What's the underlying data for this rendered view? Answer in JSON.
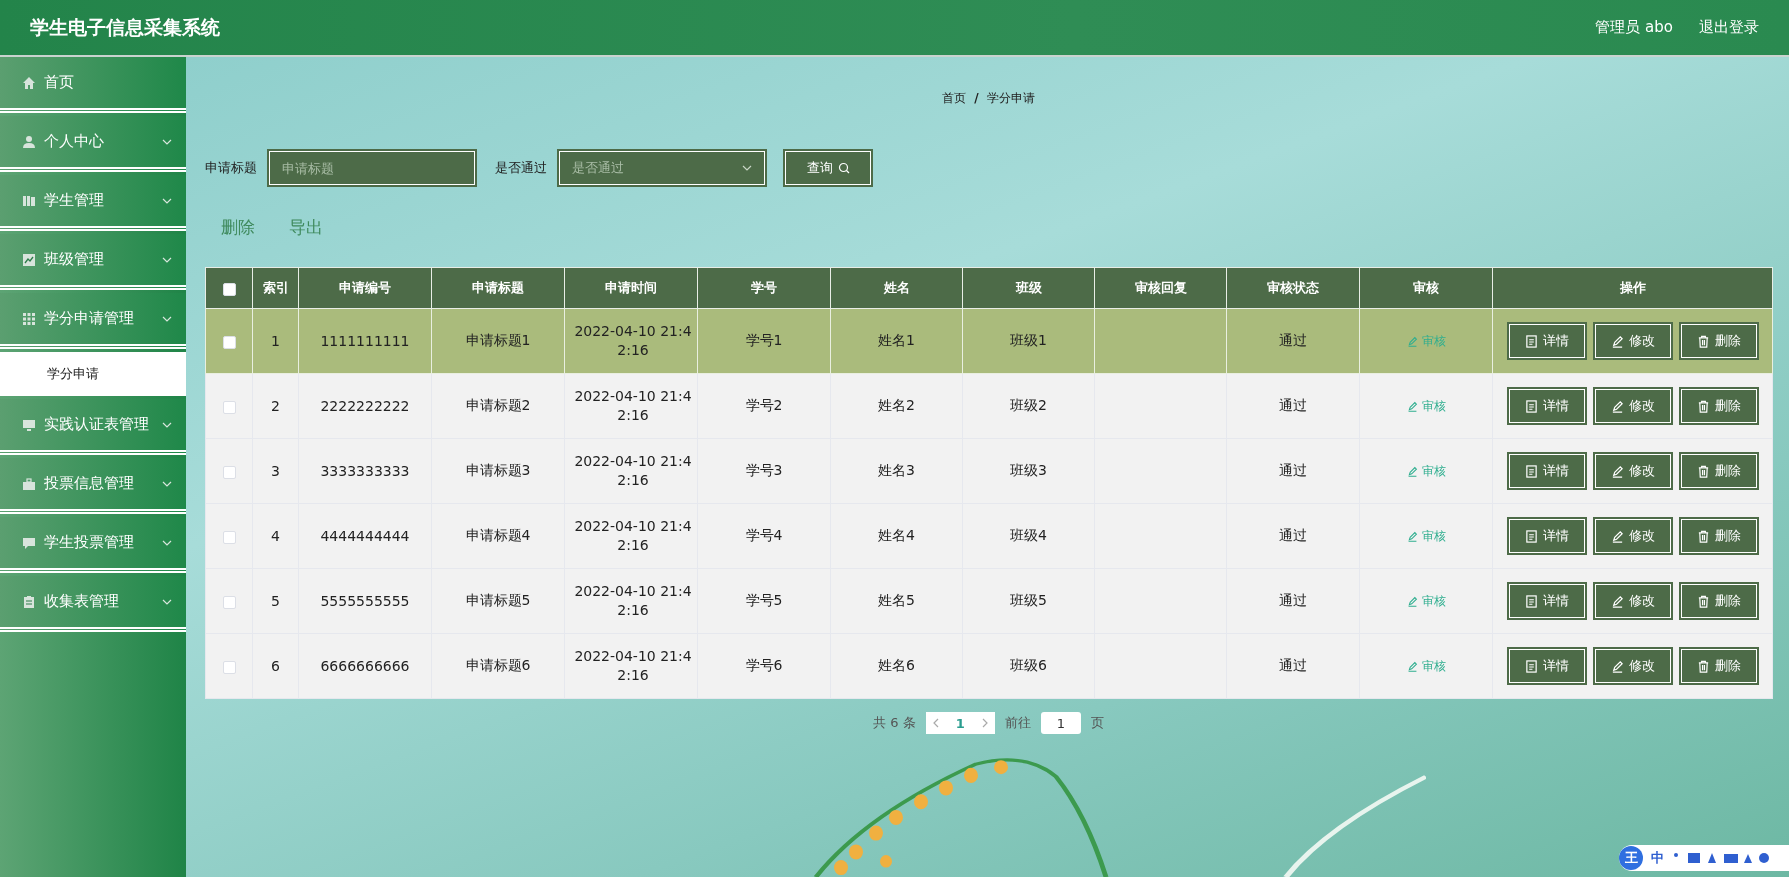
{
  "header": {
    "title": "学生电子信息采集系统",
    "user": "管理员 abo",
    "logout": "退出登录"
  },
  "sidebar": {
    "items": [
      {
        "label": "首页",
        "kind": "item"
      },
      {
        "label": "个人中心",
        "kind": "submenu"
      },
      {
        "label": "学生管理",
        "kind": "submenu"
      },
      {
        "label": "班级管理",
        "kind": "submenu"
      },
      {
        "label": "学分申请管理",
        "kind": "submenu",
        "children": [
          {
            "label": "学分申请",
            "selected": true
          }
        ]
      },
      {
        "label": "实践认证表管理",
        "kind": "submenu"
      },
      {
        "label": "投票信息管理",
        "kind": "submenu"
      },
      {
        "label": "学生投票管理",
        "kind": "submenu"
      },
      {
        "label": "收集表管理",
        "kind": "submenu"
      }
    ]
  },
  "breadcrumb": {
    "items": [
      "首页",
      "学分申请"
    ],
    "separator": "/"
  },
  "search": {
    "fields": [
      {
        "label": "申请标题",
        "placeholder": "申请标题",
        "kind": "input"
      },
      {
        "label": "是否通过",
        "placeholder": "是否通过",
        "kind": "select"
      }
    ],
    "button": "查询"
  },
  "actions": [
    "删除",
    "导出"
  ],
  "table": {
    "header_checked": false,
    "columns": [
      "索引",
      "申请编号",
      "申请标题",
      "申请时间",
      "学号",
      "姓名",
      "班级",
      "审核回复",
      "审核状态",
      "审核",
      "操作"
    ],
    "rows": [
      {
        "selected": true,
        "checked": false,
        "index": "1",
        "number": "1111111111",
        "title": "申请标题1",
        "time": "2022-04-10 21:42:16",
        "student_id": "学号1",
        "name": "姓名1",
        "class": "班级1",
        "status": "通过",
        "review": "审核",
        "actions": [
          "详情",
          "修改",
          "删除"
        ]
      },
      {
        "selected": false,
        "checked": false,
        "index": "2",
        "number": "2222222222",
        "title": "申请标题2",
        "time": "2022-04-10 21:42:16",
        "student_id": "学号2",
        "name": "姓名2",
        "class": "班级2",
        "status": "通过",
        "review": "审核",
        "actions": [
          "详情",
          "修改",
          "删除"
        ]
      },
      {
        "selected": false,
        "checked": false,
        "index": "3",
        "number": "3333333333",
        "title": "申请标题3",
        "time": "2022-04-10 21:42:16",
        "student_id": "学号3",
        "name": "姓名3",
        "class": "班级3",
        "status": "通过",
        "review": "审核",
        "actions": [
          "详情",
          "修改",
          "删除"
        ]
      },
      {
        "selected": false,
        "checked": false,
        "index": "4",
        "number": "4444444444",
        "title": "申请标题4",
        "time": "2022-04-10 21:42:16",
        "student_id": "学号4",
        "name": "姓名4",
        "class": "班级4",
        "status": "通过",
        "review": "审核",
        "actions": [
          "详情",
          "修改",
          "删除"
        ]
      },
      {
        "selected": false,
        "checked": false,
        "index": "5",
        "number": "5555555555",
        "title": "申请标题5",
        "time": "2022-04-10 21:42:16",
        "student_id": "学号5",
        "name": "姓名5",
        "class": "班级5",
        "status": "通过",
        "review": "审核",
        "actions": [
          "详情",
          "修改",
          "删除"
        ]
      },
      {
        "selected": false,
        "checked": false,
        "index": "6",
        "number": "6666666666",
        "title": "申请标题6",
        "time": "2022-04-10 21:42:16",
        "student_id": "学号6",
        "name": "姓名6",
        "class": "班级6",
        "status": "通过",
        "review": "审核",
        "actions": [
          "详情",
          "修改",
          "删除"
        ]
      }
    ]
  },
  "pagination": {
    "total": "共 6 条",
    "pages": [
      {
        "label": "1",
        "selected": true
      }
    ],
    "goto": "前往",
    "page_value": "1",
    "page_suffix": "页"
  },
  "ime": {
    "logo": "王",
    "mode": "中"
  }
}
